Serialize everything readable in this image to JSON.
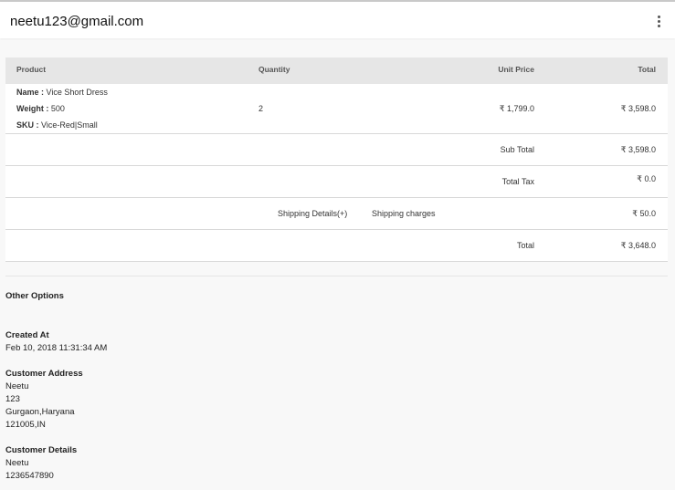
{
  "header": {
    "title": "neetu123@gmail.com"
  },
  "table": {
    "columns": [
      "Product",
      "Quantity",
      "Unit Price",
      "Total"
    ],
    "item": {
      "name_label": "Name :",
      "name_value": "Vice Short Dress",
      "weight_label": "Weight :",
      "weight_value": "500",
      "sku_label": "SKU :",
      "sku_value": "Vice-Red|Small",
      "quantity": "2",
      "unit_price": "₹ 1,799.0",
      "total": "₹ 3,598.0"
    },
    "sub_total": {
      "label": "Sub Total",
      "value": "₹ 3,598.0"
    },
    "total_tax": {
      "label": "Total Tax",
      "value": "₹ 0.0"
    },
    "shipping": {
      "link": "Shipping Details(+)",
      "label": "Shipping charges",
      "value": "₹ 50.0"
    },
    "grand_total": {
      "label": "Total",
      "value": "₹ 3,648.0"
    }
  },
  "other_options": {
    "title": "Other Options",
    "created_at": {
      "label": "Created At",
      "value": "Feb 10, 2018 11:31:34 AM"
    },
    "customer_address": {
      "label": "Customer Address",
      "lines": [
        "Neetu",
        "123",
        "Gurgaon,Haryana",
        "121005,IN"
      ]
    },
    "customer_details": {
      "label": "Customer Details",
      "lines": [
        "Neetu",
        "1236547890"
      ]
    }
  }
}
